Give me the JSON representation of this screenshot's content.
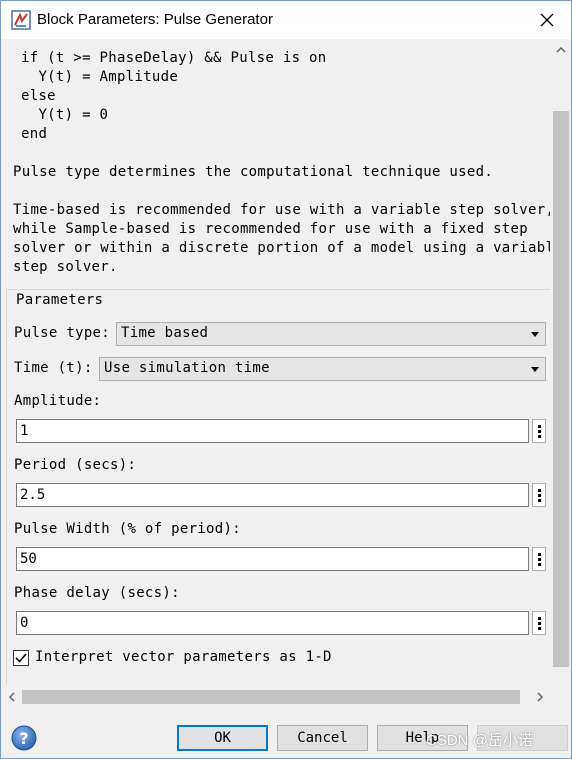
{
  "window": {
    "title": "Block Parameters: Pulse Generator"
  },
  "description": {
    "code_lines": [
      "if (t >= PhaseDelay) && Pulse is on",
      "  Y(t) = Amplitude",
      "else",
      "  Y(t) = 0",
      "end"
    ],
    "para1": "Pulse type determines the computational technique used.",
    "para2_lines": [
      "Time-based is recommended for use with a variable step solver,",
      "while Sample-based is recommended for use with a fixed step",
      "solver or within a discrete portion of a model using a variable",
      "step solver."
    ]
  },
  "parameters": {
    "legend": "Parameters",
    "pulse_type": {
      "label": "Pulse type:",
      "value": "Time based"
    },
    "time": {
      "label": "Time (t):",
      "value": "Use simulation time"
    },
    "amplitude": {
      "label": "Amplitude:",
      "value": "1"
    },
    "period": {
      "label": "Period (secs):",
      "value": "2.5"
    },
    "pulse_width": {
      "label": "Pulse Width (% of period):",
      "value": "50"
    },
    "phase_delay": {
      "label": "Phase delay (secs):",
      "value": "0"
    },
    "interpret_vector": {
      "label": "Interpret vector parameters as 1-D",
      "checked": true
    }
  },
  "buttons": {
    "ok": "OK",
    "cancel": "Cancel",
    "help": "Help"
  },
  "watermark": "CSDN @岳小诺",
  "icons": {
    "app": "simulink-block-icon",
    "close": "close-icon",
    "help": "help-question-icon",
    "param_menu": "vertical-ellipsis-icon"
  },
  "colors": {
    "accent": "#0078d7",
    "help_icon": "#3b78c4"
  }
}
